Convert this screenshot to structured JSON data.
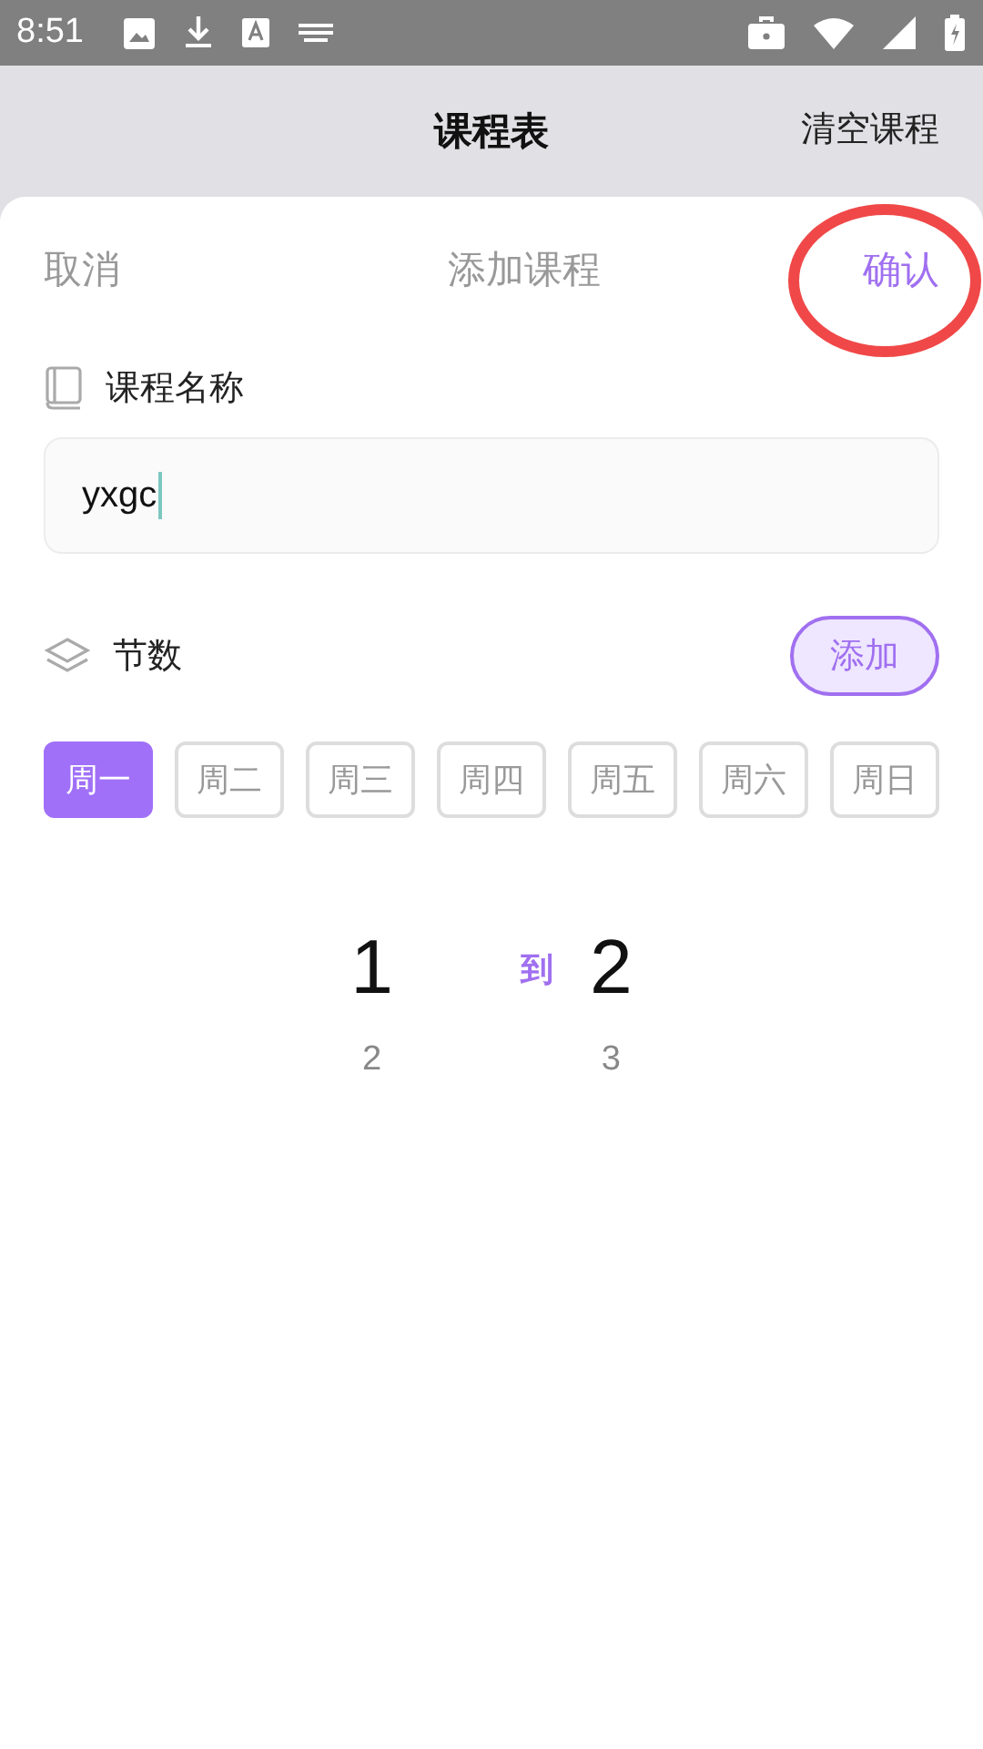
{
  "status_bar": {
    "time": "8:51"
  },
  "header": {
    "title": "课程表",
    "action": "清空课程"
  },
  "sheet": {
    "cancel": "取消",
    "title": "添加课程",
    "confirm": "确认",
    "name_label": "课程名称",
    "name_value": "yxgc",
    "sections_label": "节数",
    "add_button": "添加",
    "days": [
      {
        "label": "周一",
        "selected": true
      },
      {
        "label": "周二",
        "selected": false
      },
      {
        "label": "周三",
        "selected": false
      },
      {
        "label": "周四",
        "selected": false
      },
      {
        "label": "周五",
        "selected": false
      },
      {
        "label": "周六",
        "selected": false
      },
      {
        "label": "周日",
        "selected": false
      }
    ],
    "picker": {
      "start": {
        "current": "1",
        "next": "2"
      },
      "connector": "到",
      "end": {
        "current": "2",
        "next": "3"
      }
    }
  }
}
